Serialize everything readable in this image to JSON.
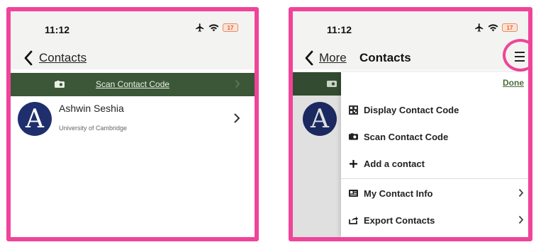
{
  "left": {
    "status": {
      "time": "11:12",
      "battery": "17"
    },
    "nav": {
      "back_label": "Contacts"
    },
    "scan_bar": {
      "label": "Scan Contact Code"
    },
    "contact": {
      "avatar_letter": "A",
      "name": "Ashwin Seshia",
      "org": "University of Cambridge"
    }
  },
  "right": {
    "status": {
      "time": "11:12",
      "battery": "17"
    },
    "nav": {
      "back_label": "More",
      "title": "Contacts"
    },
    "sheet": {
      "done_label": "Done",
      "items": [
        {
          "label": "Display Contact Code",
          "icon": "qr-code-icon"
        },
        {
          "label": "Scan Contact Code",
          "icon": "camera-icon"
        },
        {
          "label": "Add a contact",
          "icon": "plus-icon"
        },
        {
          "label": "My Contact Info",
          "icon": "id-card-icon"
        },
        {
          "label": "Export Contacts",
          "icon": "share-icon"
        }
      ]
    }
  },
  "colors": {
    "highlight": "#f0449a",
    "scan_bar": "#3b5738",
    "avatar": "#1f2f6e",
    "done": "#4a6b3c"
  }
}
